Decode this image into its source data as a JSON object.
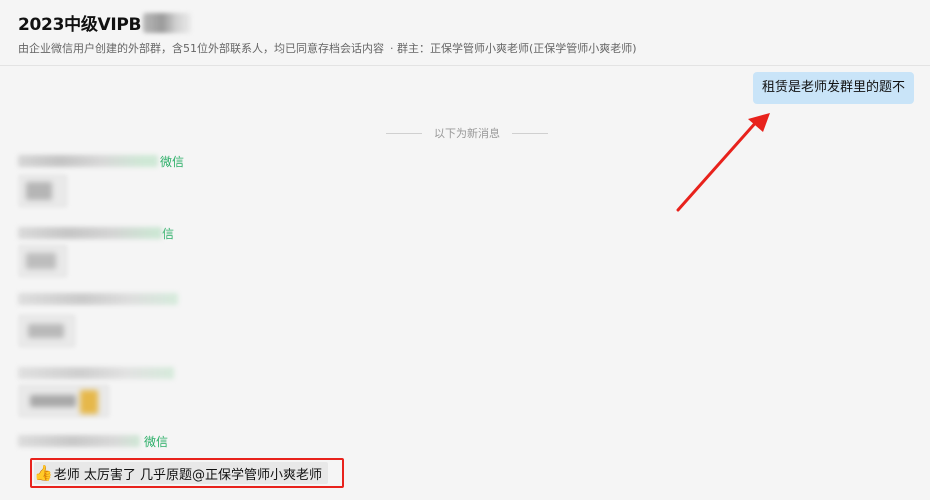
{
  "header": {
    "title": "2023中级VIPB",
    "subtitle": "由企业微信用户创建的外部群，含51位外部联系人，均已同意存档会话内容",
    "group_owner": "· 群主：正保学管师小爽老师(正保学管师小爽老师)"
  },
  "messages": {
    "outgoing": {
      "text": "租赁是老师发群里的题不"
    },
    "divider_text": "以下为新消息",
    "sender_suffixes": [
      "微信",
      "信",
      "微信"
    ],
    "last": {
      "icon": "thumbs-up-icon",
      "text": "老师 太厉害了 几乎原题@正保学管师小爽老师"
    }
  },
  "colors": {
    "accent_green": "#2aae67",
    "bubble_blue": "#c9e4f8",
    "highlight_red": "#e8221c"
  }
}
